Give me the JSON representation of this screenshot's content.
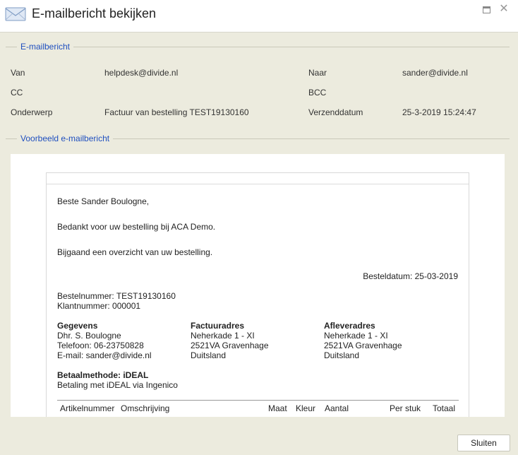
{
  "window": {
    "title": "E-mailbericht bekijken",
    "close_glyph": "✕"
  },
  "email_section": {
    "legend": "E-mailbericht",
    "from_label": "Van",
    "from_value": "helpdesk@divide.nl",
    "to_label": "Naar",
    "to_value": "sander@divide.nl",
    "cc_label": "CC",
    "cc_value": "",
    "bcc_label": "BCC",
    "bcc_value": "",
    "subject_label": "Onderwerp",
    "subject_value": "Factuur van bestelling TEST19130160",
    "sent_label": "Verzenddatum",
    "sent_value": "25-3-2019 15:24:47"
  },
  "preview_section": {
    "legend": "Voorbeeld e-mailbericht"
  },
  "mail": {
    "greeting": "Beste Sander Boulogne,",
    "thanks": "Bedankt voor uw bestelling bij ACA Demo.",
    "overview": "Bijgaand een overzicht van uw bestelling.",
    "order_date": "Besteldatum: 25-03-2019",
    "order_number": "Bestelnummer: TEST19130160",
    "customer_number": "Klantnummer: 000001",
    "details": {
      "heading": "Gegevens",
      "name": "Dhr. S. Boulogne",
      "phone": "Telefoon: 06-23750828",
      "email": "E-mail: sander@divide.nl"
    },
    "billing": {
      "heading": "Factuuradres",
      "street": "Neherkade 1 - XI",
      "city": "2521VA Gravenhage",
      "country": "Duitsland"
    },
    "delivery": {
      "heading": "Afleveradres",
      "street": "Neherkade 1 - XI",
      "city": "2521VA Gravenhage",
      "country": "Duitsland"
    },
    "payment": {
      "heading": "Betaalmethode: iDEAL",
      "text": "Betaling met iDEAL via Ingenico"
    },
    "table_headers": [
      "Artikelnummer",
      "Omschrijving",
      "Maat",
      "Kleur",
      "Aantal",
      "Per stuk",
      "Totaal"
    ]
  },
  "footer": {
    "close_label": "Sluiten"
  },
  "colors": {
    "background": "#ecebde",
    "legend_text": "#1f4fbf"
  }
}
